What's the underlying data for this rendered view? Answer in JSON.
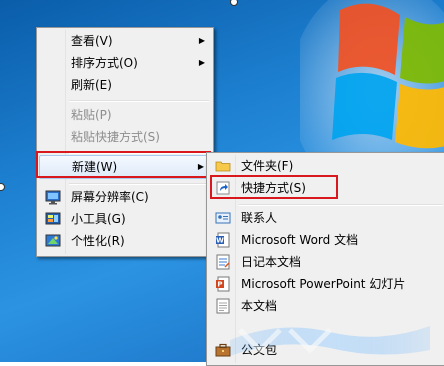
{
  "context_menu": {
    "items": [
      {
        "label": "查看(V)",
        "has_submenu": true
      },
      {
        "label": "排序方式(O)",
        "has_submenu": true
      },
      {
        "label": "刷新(E)"
      },
      {
        "label": "粘贴(P)",
        "disabled": true
      },
      {
        "label": "粘贴快捷方式(S)",
        "disabled": true
      },
      {
        "label": "新建(W)",
        "has_submenu": true,
        "highlighted": true
      },
      {
        "label": "屏幕分辨率(C)",
        "icon": "display-icon"
      },
      {
        "label": "小工具(G)",
        "icon": "gadgets-icon"
      },
      {
        "label": "个性化(R)",
        "icon": "personalize-icon"
      }
    ]
  },
  "new_submenu": {
    "items": [
      {
        "label": "文件夹(F)",
        "icon": "folder-icon"
      },
      {
        "label": "快捷方式(S)",
        "icon": "shortcut-icon",
        "highlighted": true
      },
      {
        "label": "联系人",
        "icon": "contact-icon"
      },
      {
        "label": "Microsoft Word 文档",
        "icon": "word-icon"
      },
      {
        "label": "日记本文档",
        "icon": "journal-icon"
      },
      {
        "label": "Microsoft PowerPoint 幻灯片",
        "icon": "powerpoint-icon"
      },
      {
        "label": "本文档",
        "icon": "text-document-icon"
      },
      {
        "label": "公文包",
        "icon": "briefcase-icon"
      }
    ]
  },
  "colors": {
    "highlight_box": "#d9181e",
    "menu_background": "#f0f0f0",
    "desktop_blue": "#1d7fd0"
  }
}
